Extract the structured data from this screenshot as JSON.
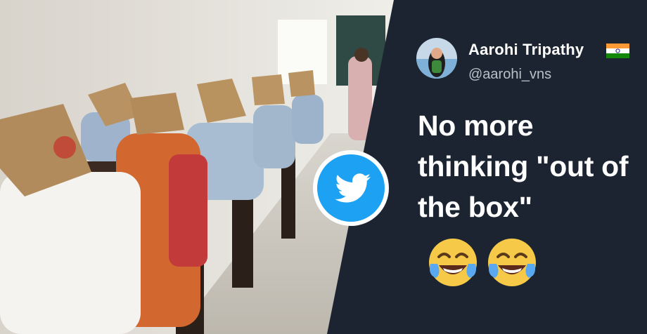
{
  "tweet": {
    "author_name": "Aarohi Tripathy",
    "handle": "@aarohi_vns",
    "text": "No more thinking \"out of the box\""
  },
  "icons": {
    "flag": "india-flag-icon",
    "emoji": "face-with-tears-of-joy-icon",
    "emoji_count": 2,
    "platform": "twitter-bird-icon"
  },
  "colors": {
    "panel_bg": "#1b2430",
    "twitter_blue": "#1da1f2",
    "text_primary": "#ffffff",
    "text_secondary": "#b8c0c8"
  }
}
